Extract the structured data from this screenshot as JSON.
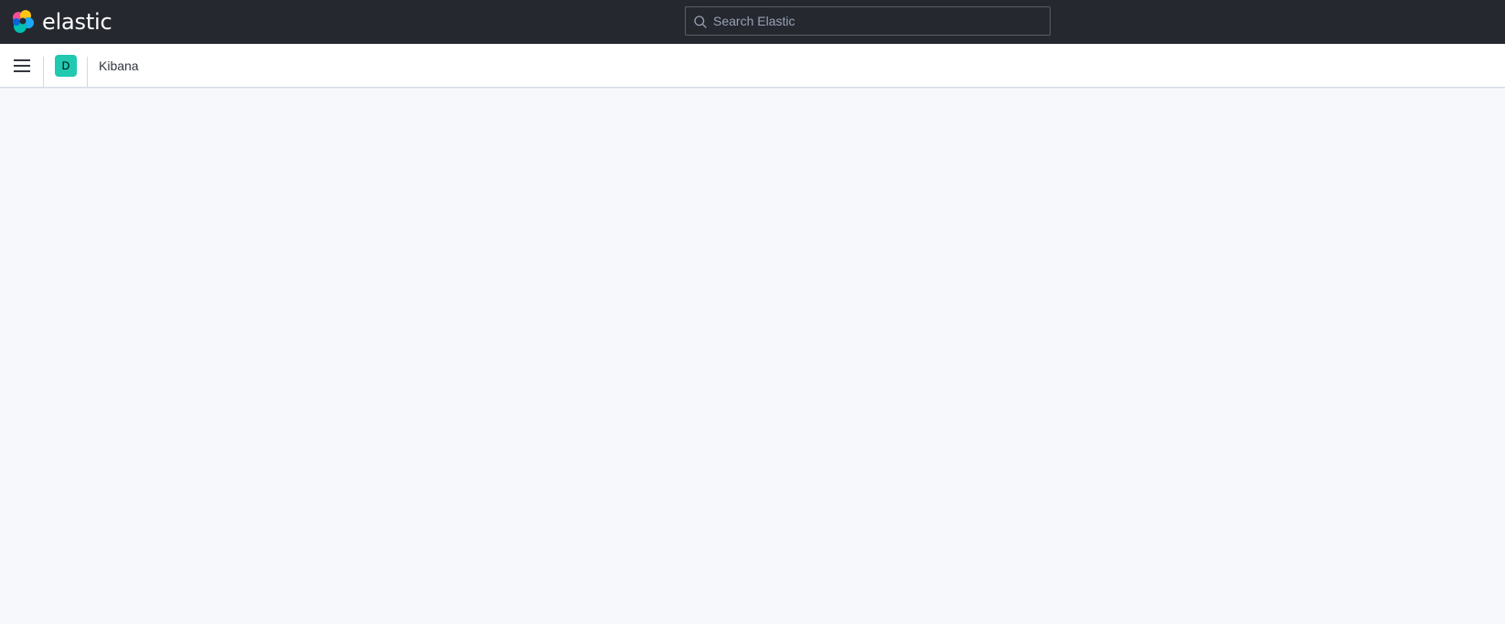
{
  "header": {
    "logo_text": "elastic",
    "search": {
      "placeholder": "Search Elastic",
      "value": ""
    }
  },
  "subheader": {
    "menu_icon": "hamburger-menu-icon",
    "space_avatar": {
      "initial": "D",
      "color": "#20c9b0"
    },
    "breadcrumb": "Kibana"
  },
  "colors": {
    "top_header_bg": "#25282f",
    "subheader_bg": "#ffffff",
    "page_bg": "#f7f8fc"
  }
}
